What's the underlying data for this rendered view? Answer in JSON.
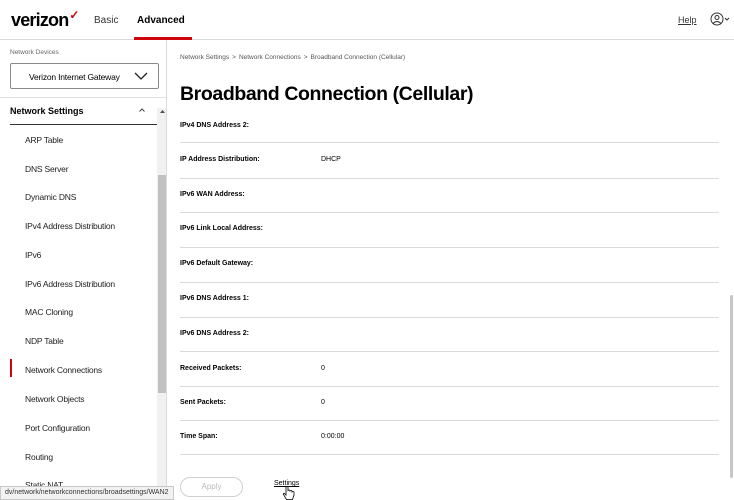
{
  "header": {
    "logo_text": "verizon",
    "logo_check": "✓",
    "nav_basic": "Basic",
    "nav_advanced": "Advanced",
    "help": "Help",
    "accent_color": "#cd040b"
  },
  "sidebar": {
    "devices_label": "Network Devices",
    "device_selected": "Verizon Internet Gateway",
    "section_title": "Network Settings",
    "items": [
      {
        "label": "ARP Table"
      },
      {
        "label": "DNS Server"
      },
      {
        "label": "Dynamic DNS"
      },
      {
        "label": "IPv4 Address Distribution"
      },
      {
        "label": "IPv6"
      },
      {
        "label": "IPv6 Address Distribution"
      },
      {
        "label": "MAC Cloning"
      },
      {
        "label": "NDP Table"
      },
      {
        "label": "Network Connections",
        "active": true
      },
      {
        "label": "Network Objects"
      },
      {
        "label": "Port Configuration"
      },
      {
        "label": "Routing"
      },
      {
        "label": "Static NAT"
      }
    ]
  },
  "main": {
    "breadcrumb": [
      "Network Settings",
      "Network Connections",
      "Broadband Connection (Cellular)"
    ],
    "breadcrumb_sep": ">",
    "title": "Broadband Connection (Cellular)",
    "rows": [
      {
        "label": "IPv4 DNS Address 2:",
        "value": ""
      },
      {
        "label": "IP Address Distribution:",
        "value": "DHCP"
      },
      {
        "label": "IPv6 WAN Address:",
        "value": ""
      },
      {
        "label": "IPv6 Link Local Address:",
        "value": ""
      },
      {
        "label": "IPv6 Default Gateway:",
        "value": ""
      },
      {
        "label": "IPv6 DNS Address 1:",
        "value": ""
      },
      {
        "label": "IPv6 DNS Address 2:",
        "value": ""
      },
      {
        "label": "Received Packets:",
        "value": "0"
      },
      {
        "label": "Sent Packets:",
        "value": "0"
      },
      {
        "label": "Time Span:",
        "value": "0:00:00"
      }
    ],
    "apply_label": "Apply",
    "settings_link": "Settings"
  },
  "status_bar": {
    "url": "dv/network/networkconnections/broadsettings/WAN2"
  }
}
